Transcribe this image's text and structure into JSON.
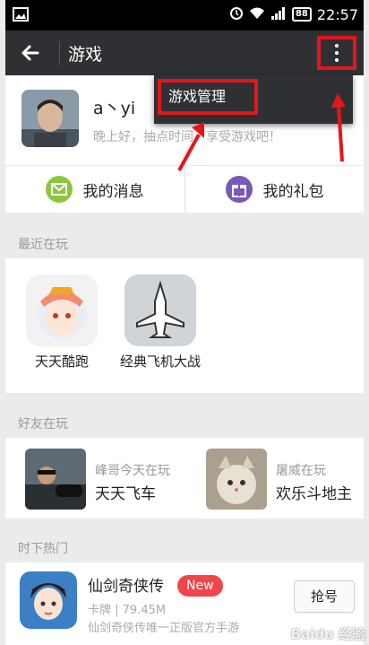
{
  "status_bar": {
    "time": "22:57",
    "battery": "88"
  },
  "app_bar": {
    "title": "游戏"
  },
  "popup_menu": {
    "items": [
      {
        "label": "游戏管理"
      }
    ]
  },
  "profile": {
    "name": "a丶yi",
    "greeting": "晚上好，抽点时间，享受游戏吧！"
  },
  "actions": [
    {
      "label": "我的消息",
      "icon": "envelope-icon",
      "color": "#8cc63f"
    },
    {
      "label": "我的礼包",
      "icon": "gift-icon",
      "color": "#7a58b8"
    }
  ],
  "recent": {
    "label": "最近在玩",
    "games": [
      {
        "name": "天天酷跑"
      },
      {
        "name": "经典飞机大战"
      }
    ]
  },
  "friends": {
    "label": "好友在玩",
    "items": [
      {
        "who": "峰哥今天在玩",
        "game": "天天飞车"
      },
      {
        "who": "屠威在玩",
        "game": "欢乐斗地主"
      }
    ]
  },
  "hot": {
    "label": "时下热门",
    "items": [
      {
        "title": "仙剑奇侠传",
        "badge": "New",
        "meta": "卡牌 | 79.45M",
        "desc": "仙剑奇侠传唯一正版官方手游",
        "button": "抢号"
      }
    ]
  },
  "watermark": "Baidu 经验",
  "colors": {
    "accent_red": "#e4161c",
    "appbar": "#2f3033",
    "badge": "#f0464b"
  }
}
